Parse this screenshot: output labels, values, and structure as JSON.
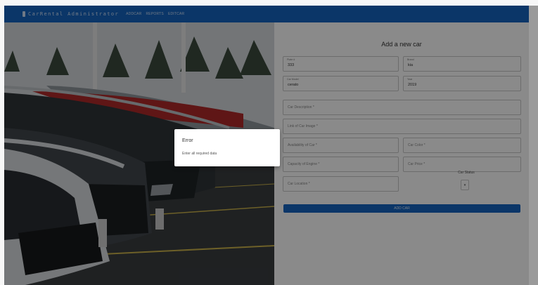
{
  "nav": {
    "brand": "CarRental Administrator",
    "brand_icon": "car-icon",
    "links": [
      "ADDCAR",
      "REPORTS",
      "EDITCAR"
    ]
  },
  "form": {
    "title": "Add a new car",
    "fields": {
      "plate": {
        "label": "Plate #",
        "value": "333"
      },
      "brand": {
        "label": "Brand",
        "value": "kia"
      },
      "model": {
        "label": "Car Model",
        "value": "cerato"
      },
      "year": {
        "label": "Year",
        "value": "2019"
      },
      "description": {
        "placeholder": "Car Description *"
      },
      "image_link": {
        "placeholder": "Link of Car Image *"
      },
      "availability": {
        "placeholder": "Availability of Car *"
      },
      "color": {
        "placeholder": "Car Color *"
      },
      "engine": {
        "placeholder": "Capacity of Engine *"
      },
      "price": {
        "placeholder": "Car Price *"
      },
      "location": {
        "placeholder": "Car Location *"
      }
    },
    "status": {
      "label": "Car Status",
      "value": ""
    },
    "submit_label": "ADD CAR"
  },
  "dialog": {
    "title": "Error",
    "message": "Enter all required data"
  },
  "colors": {
    "primary": "#1565c0",
    "overlay": "rgba(0,0,0,0.46)"
  }
}
